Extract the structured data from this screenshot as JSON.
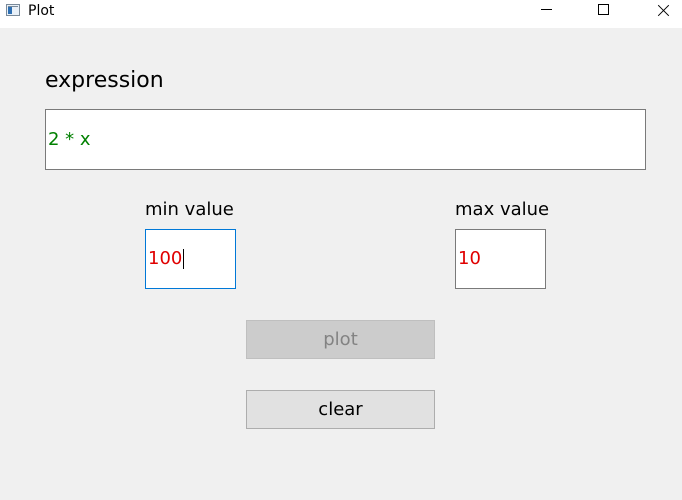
{
  "window": {
    "title": "Plot",
    "icon": "app-window-icon",
    "controls": [
      "minimize",
      "maximize",
      "close"
    ]
  },
  "form": {
    "expression_label": "expression",
    "expression_value": "2 * x",
    "min_label": "min value",
    "min_value": "100",
    "max_label": "max value",
    "max_value": "10",
    "plot_button": "plot",
    "plot_enabled": false,
    "clear_button": "clear"
  },
  "colors": {
    "background": "#f0f0f0",
    "expression_text": "#008000",
    "invalid_value_text": "#e00000",
    "focus_border": "#0078d7"
  }
}
